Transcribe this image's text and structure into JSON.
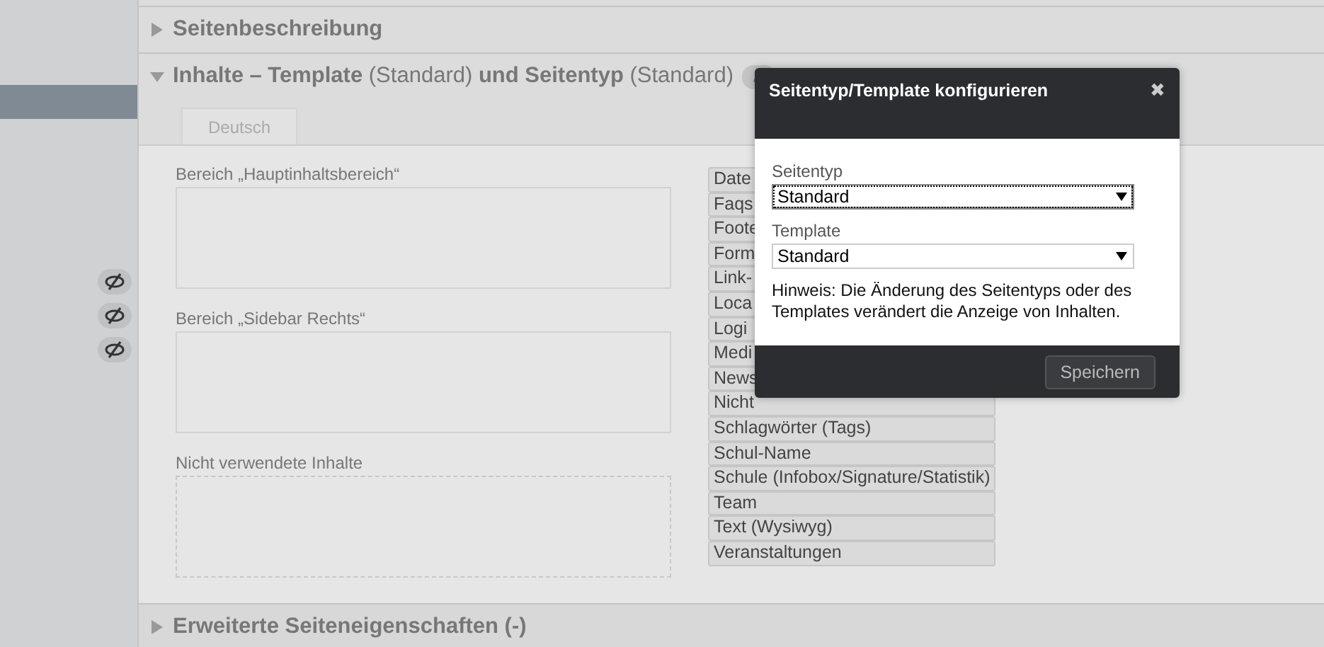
{
  "sidebar": {
    "items": [
      {
        "selected": true
      }
    ],
    "visibility_toggles": [
      {
        "hidden": true
      },
      {
        "hidden": true
      },
      {
        "hidden": true
      }
    ]
  },
  "sections": [
    {
      "title": "Seitenbeschreibung",
      "expanded": false
    },
    {
      "title": "**Inhalte – Template** (Standard) **und Seitentyp** (Standard)",
      "expanded": true,
      "editable": true,
      "tabs": [
        {
          "label": "Deutsch",
          "selected": true
        }
      ],
      "areas": [
        {
          "label": "Bereich „Hauptinhaltsbereich“",
          "kind": "solid"
        },
        {
          "label": "Bereich „Sidebar Rechts“",
          "kind": "solid"
        },
        {
          "label": "Nicht verwendete Inhalte",
          "kind": "dashed"
        }
      ],
      "content_types": [
        "Date",
        "Faqs",
        "Foote",
        "Form",
        "Link-",
        "Loca",
        "Logi",
        "Medi",
        "News",
        "Nicht",
        "Schlagwörter (Tags)",
        "Schul-Name",
        "Schule (Infobox/Signature/Statistik)",
        "Team",
        "Text (Wysiwyg)",
        "Veranstaltungen"
      ]
    },
    {
      "title": "Erweiterte Seiteneigenschaften (-)",
      "expanded": false
    }
  ],
  "dialog": {
    "title": "Seitentyp/Template konfigurieren",
    "close": "✖",
    "fields": [
      {
        "label": "Seitentyp",
        "value": "Standard",
        "focused": true
      },
      {
        "label": "Template",
        "value": "Standard",
        "focused": false
      }
    ],
    "hint": "Hinweis: Die Änderung des Seitentyps oder des Templates verändert die Anzeige von Inhalten.",
    "button": "Speichern"
  }
}
